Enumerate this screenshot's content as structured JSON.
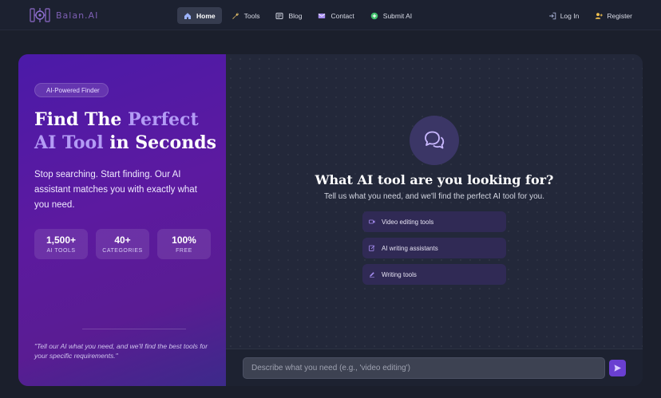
{
  "brand": {
    "name": "Balan.AI",
    "logo_icon": "brain-circuit-icon"
  },
  "nav": {
    "links": [
      {
        "label": "Home",
        "icon": "home-icon",
        "active": true
      },
      {
        "label": "Tools",
        "icon": "wrench-icon",
        "active": false
      },
      {
        "label": "Blog",
        "icon": "newspaper-icon",
        "active": false
      },
      {
        "label": "Contact",
        "icon": "envelope-icon",
        "active": false
      },
      {
        "label": "Submit AI",
        "icon": "plus-circle-icon",
        "active": false
      }
    ],
    "auth": [
      {
        "label": "Log In",
        "icon": "login-icon"
      },
      {
        "label": "Register",
        "icon": "user-plus-icon"
      }
    ]
  },
  "hero": {
    "badge": "AI-Powered Finder",
    "headline_part1": "Find The ",
    "headline_accent": "Perfect AI Tool",
    "headline_part2": " in Seconds",
    "subtitle": "Stop searching. Start finding. Our AI assistant matches you with exactly what you need.",
    "stats": [
      {
        "value": "1,500+",
        "label": "AI TOOLS"
      },
      {
        "value": "40+",
        "label": "CATEGORIES"
      },
      {
        "value": "100%",
        "label": "FREE"
      }
    ],
    "quote": "\"Tell our AI what you need, and we'll find the best tools for your specific requirements.\""
  },
  "finder": {
    "icon": "chat-bubbles-icon",
    "title": "What AI tool are you looking for?",
    "subtitle": "Tell us what you need, and we'll find the perfect AI tool for you.",
    "suggestions": [
      {
        "label": "Video editing tools",
        "icon": "video-icon"
      },
      {
        "label": "AI writing assistants",
        "icon": "edit-icon"
      },
      {
        "label": "Writing tools",
        "icon": "pen-icon"
      }
    ],
    "input_placeholder": "Describe what you need (e.g., 'video editing')",
    "input_value": "",
    "send_icon": "send-icon"
  },
  "colors": {
    "accent": "#6a3fd1",
    "headline_accent": "#b39bf5",
    "background": "#1b1f2c"
  }
}
